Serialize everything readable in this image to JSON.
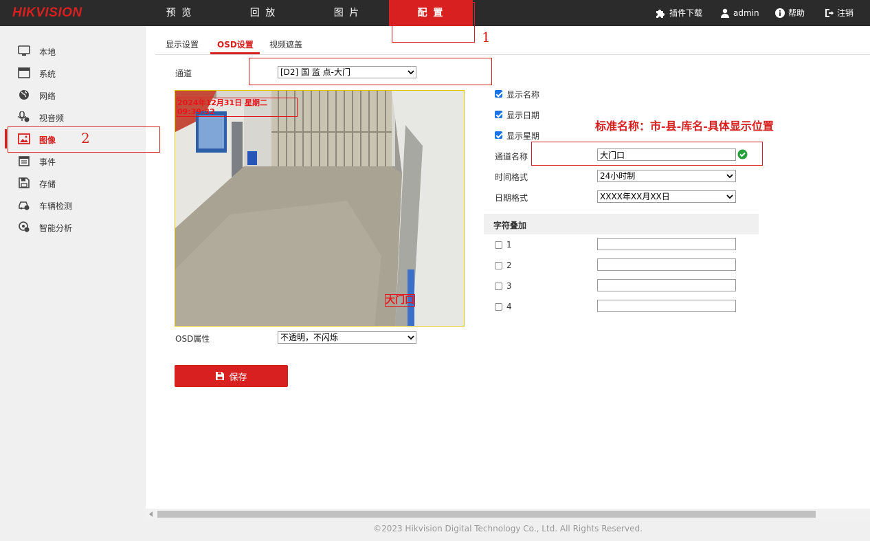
{
  "header": {
    "logo": "HIKVISION",
    "nav": [
      "预 览",
      "回 放",
      "图 片",
      "配 置"
    ],
    "plugin_download": "插件下载",
    "user": "admin",
    "help": "帮助",
    "logout": "注销",
    "accent_color": "#d7201f"
  },
  "sidebar": {
    "items": [
      {
        "label": "本地",
        "icon": "monitor-icon"
      },
      {
        "label": "系统",
        "icon": "system-icon"
      },
      {
        "label": "网络",
        "icon": "globe-icon"
      },
      {
        "label": "视音频",
        "icon": "microphone-icon"
      },
      {
        "label": "图像",
        "icon": "image-icon"
      },
      {
        "label": "事件",
        "icon": "calendar-icon"
      },
      {
        "label": "存储",
        "icon": "save-icon"
      },
      {
        "label": "车辆检测",
        "icon": "vehicle-icon"
      },
      {
        "label": "智能分析",
        "icon": "analytics-icon"
      }
    ]
  },
  "tabs": [
    "显示设置",
    "OSD设置",
    "视频遮盖"
  ],
  "form": {
    "channel_label": "通道",
    "channel_value": "[D2] 国 监 点-大门",
    "osd_attr_label": "OSD属性",
    "osd_attr_value": "不透明，不闪烁",
    "show_name": "显示名称",
    "show_date": "显示日期",
    "show_week": "显示星期",
    "channel_name_label": "通道名称",
    "channel_name_value": "大门口",
    "time_format_label": "时间格式",
    "time_format_value": "24小时制",
    "date_format_label": "日期格式",
    "date_format_value": "XXXX年XX月XX日",
    "text_overlay_head": "字符叠加",
    "overlay_rows": [
      "1",
      "2",
      "3",
      "4"
    ],
    "save_label": "保存"
  },
  "video": {
    "osd_datetime": "2024年12月31日 星期二 09:39:32",
    "osd_name": "大门口"
  },
  "annotations": {
    "num1": "1",
    "num2": "2",
    "note": "标准名称：市-县-库名-具体显示位置"
  },
  "footer": "©2023 Hikvision Digital Technology Co., Ltd. All Rights Reserved."
}
